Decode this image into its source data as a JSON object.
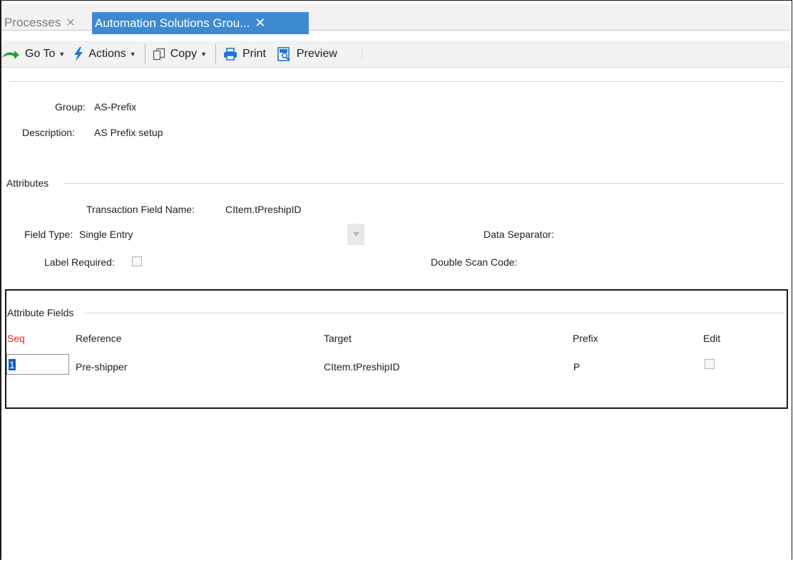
{
  "tabs": [
    {
      "label": "Processes",
      "close": "✕",
      "active": false
    },
    {
      "label": "Automation Solutions Grou...",
      "close": "✕",
      "active": true
    }
  ],
  "toolbar": {
    "goto_label": "Go To",
    "actions_label": "Actions",
    "copy_label": "Copy",
    "print_label": "Print",
    "preview_label": "Preview"
  },
  "header": {
    "group_label": "Group:",
    "group_value": "AS-Prefix",
    "description_label": "Description:",
    "description_value": "AS Prefix setup"
  },
  "attributes": {
    "section_title": "Attributes",
    "transaction_field_label": "Transaction Field Name:",
    "transaction_field_value": "CItem.tPreshipID",
    "field_type_label": "Field Type:",
    "field_type_value": "Single Entry",
    "data_separator_label": "Data Separator:",
    "label_required_label": "Label Required:",
    "double_scan_code_label": "Double Scan Code:"
  },
  "attribute_fields": {
    "section_title": "Attribute Fields",
    "columns": {
      "seq": "Seq",
      "reference": "Reference",
      "target": "Target",
      "prefix": "Prefix",
      "edit": "Edit"
    },
    "rows": [
      {
        "seq": "1",
        "reference": "Pre-shipper",
        "target": "CItem.tPreshipID",
        "prefix": "P",
        "edit": false
      }
    ]
  },
  "colors": {
    "active_tab": "#3e8ad1",
    "seq_header": "#e8262a",
    "toolbar_bg": "#f2f2f2",
    "selection": "#0f5fc7"
  }
}
